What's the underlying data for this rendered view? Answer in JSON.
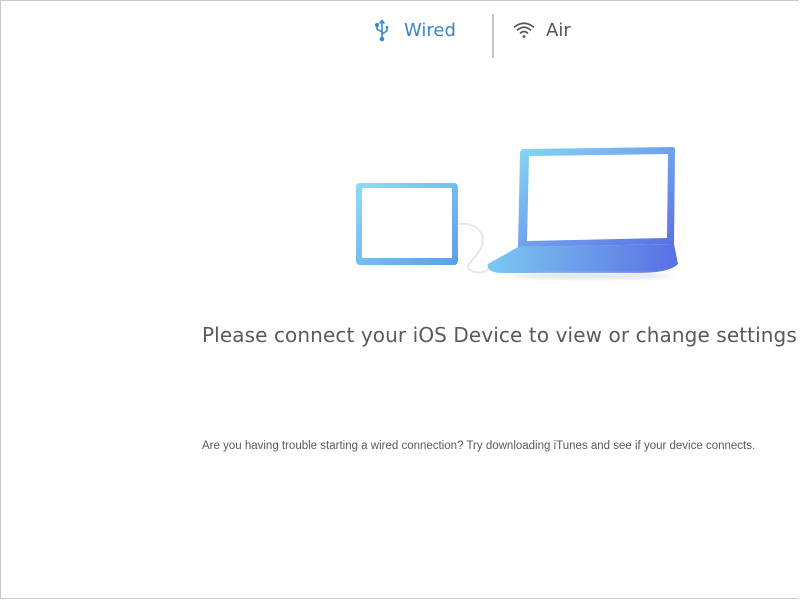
{
  "tabs": {
    "wired": {
      "label": "Wired",
      "icon": "usb-icon",
      "active": true,
      "color": "#3a86c6"
    },
    "air": {
      "label": "Air",
      "icon": "wifi-icon",
      "active": false,
      "color": "#555555"
    }
  },
  "main": {
    "illustration": "tablet-and-laptop-connected-illustration",
    "message": "Please connect your iOS Device to view or change settings",
    "help_text": "Are you having trouble starting a wired connection?  Try downloading iTunes and see if your device connects."
  },
  "colors": {
    "accent": "#3a86c6",
    "device_gradient_start": "#8fdcf5",
    "device_gradient_end": "#5b6fe6"
  }
}
